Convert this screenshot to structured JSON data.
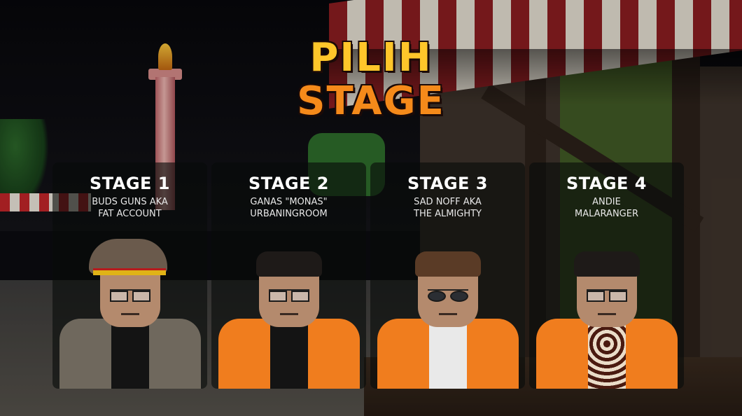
{
  "title": {
    "line1": "PILIH",
    "line2": "STAGE"
  },
  "stages": [
    {
      "title": "STAGE 1",
      "line1": "BUDS GUNS AKA",
      "line2": "FAT ACCOUNT"
    },
    {
      "title": "STAGE 2",
      "line1": "GANAS \"MONAS\"",
      "line2": "URBANINGROOM"
    },
    {
      "title": "STAGE 3",
      "line1": "SAD NOFF AKA",
      "line2": "THE ALMIGHTY"
    },
    {
      "title": "STAGE 4",
      "line1": "ANDIE",
      "line2": "MALARANGER"
    }
  ],
  "colors": {
    "title_top": "#ffc62a",
    "title_bottom": "#f58a1a",
    "card_background": "rgba(8,12,10,0.62)",
    "text": "#ffffff",
    "vest": "#f07d1e"
  }
}
